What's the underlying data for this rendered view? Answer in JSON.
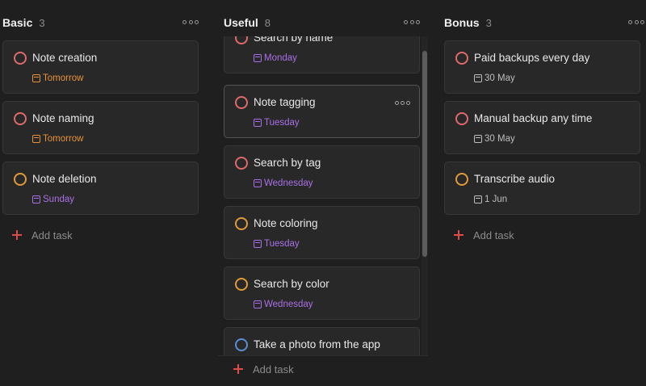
{
  "columns": [
    {
      "title": "Basic",
      "count": "3",
      "add_label": "Add task",
      "tasks": [
        {
          "name": "Note creation",
          "due": "Tomorrow",
          "due_color": "orange",
          "priority": "p1"
        },
        {
          "name": "Note naming",
          "due": "Tomorrow",
          "due_color": "orange",
          "priority": "p1"
        },
        {
          "name": "Note deletion",
          "due": "Sunday",
          "due_color": "purple",
          "priority": "p2"
        }
      ]
    },
    {
      "title": "Useful",
      "count": "8",
      "add_label": "Add task",
      "tasks": [
        {
          "name": "Search by name",
          "due": "Monday",
          "due_color": "purple",
          "priority": "p1"
        },
        {
          "name": "Note tagging",
          "due": "Tuesday",
          "due_color": "purple",
          "priority": "p1"
        },
        {
          "name": "Search by tag",
          "due": "Wednesday",
          "due_color": "purple",
          "priority": "p1"
        },
        {
          "name": "Note coloring",
          "due": "Tuesday",
          "due_color": "purple",
          "priority": "p2"
        },
        {
          "name": "Search by color",
          "due": "Wednesday",
          "due_color": "purple",
          "priority": "p2"
        },
        {
          "name": "Take a photo from the app",
          "due": "",
          "due_color": "purple",
          "priority": "p3"
        }
      ]
    },
    {
      "title": "Bonus",
      "count": "3",
      "add_label": "Add task",
      "tasks": [
        {
          "name": "Paid backups every day",
          "due": "30 May",
          "due_color": "grey",
          "priority": "p1"
        },
        {
          "name": "Manual backup any time",
          "due": "30 May",
          "due_color": "grey",
          "priority": "p1"
        },
        {
          "name": "Transcribe audio",
          "due": "1 Jun",
          "due_color": "grey",
          "priority": "p2"
        }
      ]
    }
  ],
  "colors": {
    "background": "#1f1f1f",
    "card": "#282828",
    "priority_1": "#de6a6a",
    "priority_2": "#e09a3a",
    "priority_3": "#5a8fd6",
    "date_orange": "#e8913a",
    "date_purple": "#a970e6",
    "add_plus": "#de4c4a"
  },
  "icons": {
    "column_menu": "more-horizontal-icon",
    "task_checkbox": "circle-checkbox-icon",
    "due_date": "calendar-icon",
    "add": "plus-icon"
  }
}
